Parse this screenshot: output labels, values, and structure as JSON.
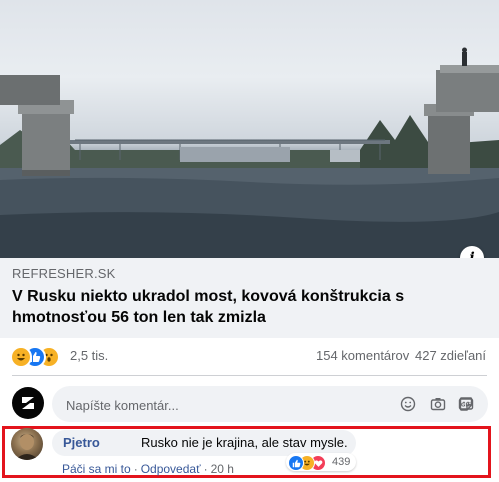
{
  "link": {
    "domain": "REFRESHER.SK",
    "title": "V Rusku niekto ukradol most, kovová konštrukcia s hmotnosťou 56 ton len tak zmizla",
    "info_icon": "info-icon"
  },
  "reactions": {
    "icons": [
      "haha-reaction-icon",
      "like-reaction-icon",
      "wow-reaction-icon"
    ],
    "count": "2,5 tis.",
    "comments": "154 komentárov",
    "shares": "427 zdieľaní"
  },
  "comment_input": {
    "placeholder": "Napíšte komentár...",
    "icons": [
      "emoji-icon",
      "camera-icon",
      "gif-icon",
      "sticker-icon"
    ]
  },
  "comment": {
    "author": "Pjetro",
    "text": "Rusko nie je krajina, ale stav mysle.",
    "like_label": "Páči sa mi to",
    "reply_label": "Odpovedať",
    "time": "20 h",
    "reaction_count": "439",
    "reaction_icons": [
      "like-reaction-icon",
      "haha-reaction-icon",
      "love-reaction-icon"
    ]
  },
  "colors": {
    "link_blue": "#385898",
    "highlight_red": "#e3141c",
    "like_blue": "#1877f2",
    "haha_yellow": "#f7b125",
    "love_red": "#f33e58",
    "meta_gray": "#65676b"
  }
}
